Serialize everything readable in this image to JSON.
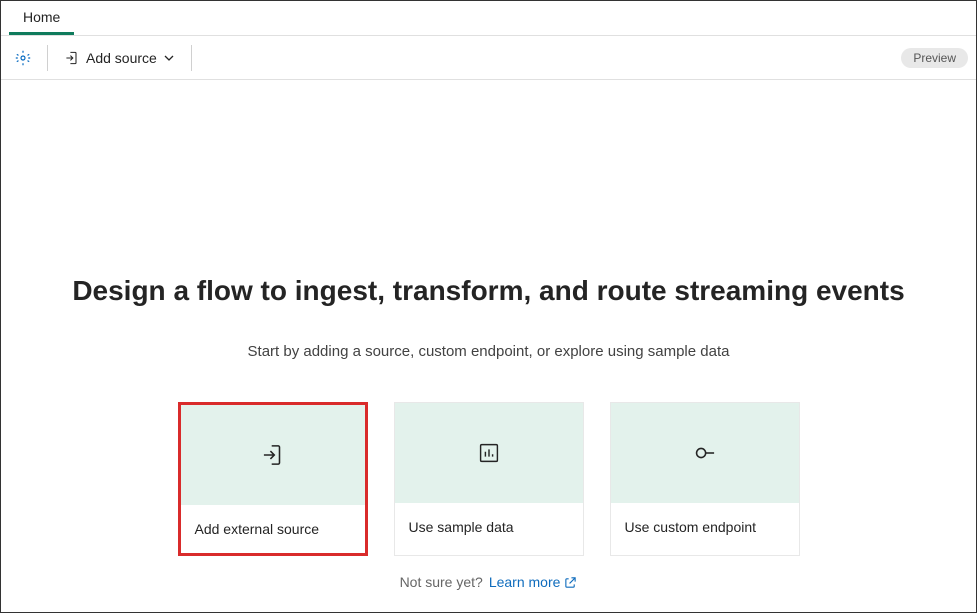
{
  "tabs": {
    "home": "Home"
  },
  "toolbar": {
    "add_source": "Add source",
    "preview_badge": "Preview"
  },
  "main": {
    "headline": "Design a flow to ingest, transform, and route streaming events",
    "subtext": "Start by adding a source, custom endpoint, or explore using sample data",
    "cards": {
      "external": "Add external source",
      "sample": "Use sample data",
      "endpoint": "Use custom endpoint"
    },
    "footer_prompt": "Not sure yet?",
    "learn_more": "Learn more"
  }
}
